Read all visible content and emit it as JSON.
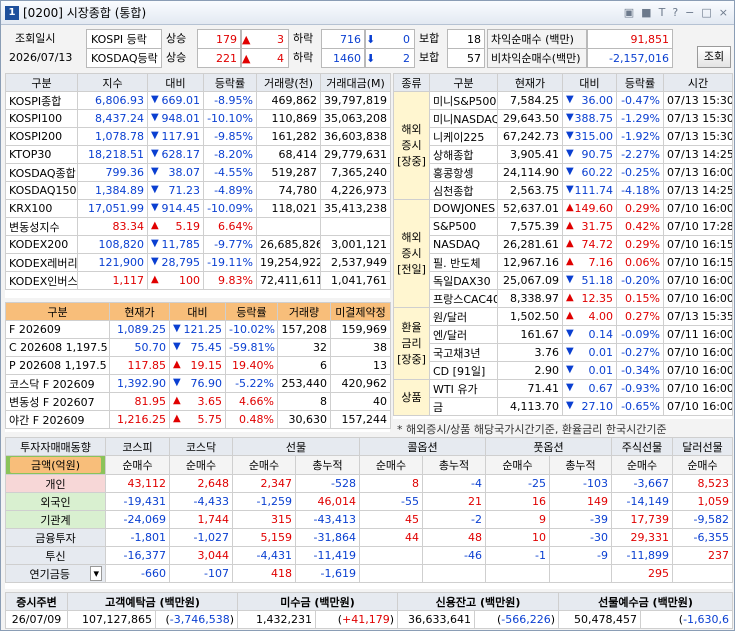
{
  "window": {
    "title_num": "1",
    "title": "[0200] 시장종합 (통합)",
    "buttons": [
      "▣",
      "■",
      "T",
      "?",
      "−",
      "□",
      "×"
    ]
  },
  "summary": {
    "query_label": "조회일시",
    "query_date": "2026/07/13",
    "kospi_label": "KOSPI 등락",
    "kosdaq_label": "KOSDAQ등락",
    "rise_label": "상승",
    "fall_label": "하락",
    "flat_label": "보합",
    "kospi": {
      "rise": "179",
      "rise_up": "3",
      "fall": "716",
      "fall_dn": "0",
      "flat": "18"
    },
    "kosdaq": {
      "rise": "221",
      "rise_up": "4",
      "fall": "1460",
      "fall_dn": "2",
      "flat": "57"
    },
    "arb_label": "차익순매수 (백만)",
    "arb_value": "91,851",
    "nonarb_label": "비차익순매수(백만)",
    "nonarb_value": "-2,157,016",
    "query_button": "조회"
  },
  "indices": {
    "headers": [
      "구분",
      "지수",
      "대비",
      "등락률",
      "거래량(천)",
      "거래대금(M)"
    ],
    "rows": [
      {
        "name": "KOSPI종합",
        "value": "6,806.93",
        "dir": "dn",
        "change": "669.01",
        "rate": "-8.95%",
        "vol": "469,862",
        "amt": "39,797,819"
      },
      {
        "name": "KOSPI100",
        "value": "8,437.24",
        "dir": "dn",
        "change": "948.01",
        "rate": "-10.10%",
        "vol": "110,869",
        "amt": "35,063,208"
      },
      {
        "name": "KOSPI200",
        "value": "1,078.78",
        "dir": "dn",
        "change": "117.91",
        "rate": "-9.85%",
        "vol": "161,282",
        "amt": "36,603,838"
      },
      {
        "name": "KTOP30",
        "value": "18,218.51",
        "dir": "dn",
        "change": "628.17",
        "rate": "-8.20%",
        "vol": "68,414",
        "amt": "29,779,631"
      },
      {
        "name": "KOSDAQ종합",
        "value": "799.36",
        "dir": "dn",
        "change": "38.07",
        "rate": "-4.55%",
        "vol": "519,287",
        "amt": "7,365,240"
      },
      {
        "name": "KOSDAQ150",
        "value": "1,384.89",
        "dir": "dn",
        "change": "71.23",
        "rate": "-4.89%",
        "vol": "74,780",
        "amt": "4,226,973"
      },
      {
        "name": "KRX100",
        "value": "17,051.99",
        "dir": "dn",
        "change": "914.45",
        "rate": "-10.09%",
        "vol": "118,021",
        "amt": "35,413,238"
      },
      {
        "name": "변동성지수",
        "value": "83.34",
        "dir": "up",
        "change": "5.19",
        "rate": "6.64%",
        "vol": "",
        "amt": ""
      },
      {
        "name": "KODEX200",
        "value": "108,820",
        "dir": "dn",
        "change": "11,785",
        "rate": "-9.77%",
        "vol": "26,685,826",
        "amt": "3,001,121"
      },
      {
        "name": "KODEX레버리",
        "value": "121,900",
        "dir": "dn",
        "change": "28,795",
        "rate": "-19.11%",
        "vol": "19,254,922",
        "amt": "2,537,949"
      },
      {
        "name": "KODEX인버스",
        "value": "1,117",
        "dir": "up",
        "change": "100",
        "rate": "9.83%",
        "vol": "72,411,611",
        "amt": "1,041,761"
      }
    ]
  },
  "futures": {
    "headers": [
      "구분",
      "현재가",
      "대비",
      "등락률",
      "거래량",
      "미결제약정"
    ],
    "rows": [
      {
        "name": "F 202609",
        "value": "1,089.25",
        "dir": "dn",
        "change": "121.25",
        "rate": "-10.02%",
        "vol": "157,208",
        "oi": "159,969"
      },
      {
        "name": "C 202608 1,197.5",
        "value": "50.70",
        "dir": "dn",
        "change": "75.45",
        "rate": "-59.81%",
        "vol": "32",
        "oi": "38"
      },
      {
        "name": "P 202608 1,197.5",
        "value": "117.85",
        "dir": "up",
        "change": "19.15",
        "rate": "19.40%",
        "vol": "6",
        "oi": "13"
      },
      {
        "name": "코스닥 F 202609",
        "value": "1,392.90",
        "dir": "dn",
        "change": "76.90",
        "rate": "-5.22%",
        "vol": "253,440",
        "oi": "420,962"
      },
      {
        "name": "변동성 F 202607",
        "value": "81.95",
        "dir": "up",
        "change": "3.65",
        "rate": "4.66%",
        "vol": "8",
        "oi": "40"
      },
      {
        "name": "야간 F 202609",
        "value": "1,216.25",
        "dir": "up",
        "change": "5.75",
        "rate": "0.48%",
        "vol": "30,630",
        "oi": "157,244"
      }
    ]
  },
  "global": {
    "headers": [
      "종류",
      "구분",
      "현재가",
      "대비",
      "등락률",
      "시간"
    ],
    "groups": [
      {
        "label": "해외\n증시\n[장중]",
        "rows": [
          {
            "name": "미니S&P500",
            "value": "7,584.25",
            "dir": "dn",
            "change": "36.00",
            "rate": "-0.47%",
            "time": "07/13 15:30"
          },
          {
            "name": "미니NASDAQ",
            "value": "29,643.50",
            "dir": "dn",
            "change": "388.75",
            "rate": "-1.29%",
            "time": "07/13 15:30"
          },
          {
            "name": "니케이225",
            "value": "67,242.73",
            "dir": "dn",
            "change": "315.00",
            "rate": "-1.92%",
            "time": "07/13 15:30"
          },
          {
            "name": "상해종합",
            "value": "3,905.41",
            "dir": "dn",
            "change": "90.75",
            "rate": "-2.27%",
            "time": "07/13 14:25"
          },
          {
            "name": "홍콩항셍",
            "value": "24,114.90",
            "dir": "dn",
            "change": "60.22",
            "rate": "-0.25%",
            "time": "07/13 16:00"
          },
          {
            "name": "심천종합",
            "value": "2,563.75",
            "dir": "dn",
            "change": "111.74",
            "rate": "-4.18%",
            "time": "07/13 14:25"
          }
        ]
      },
      {
        "label": "해외\n증시\n[전일]",
        "rows": [
          {
            "name": "DOWJONES",
            "value": "52,637.01",
            "dir": "up",
            "change": "149.60",
            "rate": "0.29%",
            "time": "07/10 16:00"
          },
          {
            "name": "S&P500",
            "value": "7,575.39",
            "dir": "up",
            "change": "31.75",
            "rate": "0.42%",
            "time": "07/10 17:28"
          },
          {
            "name": "NASDAQ",
            "value": "26,281.61",
            "dir": "up",
            "change": "74.72",
            "rate": "0.29%",
            "time": "07/10 16:15"
          },
          {
            "name": "필. 반도체",
            "value": "12,967.16",
            "dir": "up",
            "change": "7.16",
            "rate": "0.06%",
            "time": "07/10 16:15"
          },
          {
            "name": "독일DAX30",
            "value": "25,067.09",
            "dir": "dn",
            "change": "51.18",
            "rate": "-0.20%",
            "time": "07/10 16:00"
          },
          {
            "name": "프랑스CAC40",
            "value": "8,338.97",
            "dir": "up",
            "change": "12.35",
            "rate": "0.15%",
            "time": "07/10 16:00"
          }
        ]
      },
      {
        "label": "환율\n금리\n[장중]",
        "rows": [
          {
            "name": "원/달러",
            "value": "1,502.50",
            "dir": "up",
            "change": "4.00",
            "rate": "0.27%",
            "time": "07/13 15:35"
          },
          {
            "name": "엔/달러",
            "value": "161.67",
            "dir": "dn",
            "change": "0.14",
            "rate": "-0.09%",
            "time": "07/11 16:00"
          },
          {
            "name": "국고채3년",
            "value": "3.76",
            "dir": "dn",
            "change": "0.01",
            "rate": "-0.27%",
            "time": "07/10 16:00"
          },
          {
            "name": "CD [91일]",
            "value": "2.90",
            "dir": "dn",
            "change": "0.01",
            "rate": "-0.34%",
            "time": "07/10 16:00"
          }
        ]
      },
      {
        "label": "상품",
        "rows": [
          {
            "name": "WTI 유가",
            "value": "71.41",
            "dir": "dn",
            "change": "0.67",
            "rate": "-0.93%",
            "time": "07/10 16:00"
          },
          {
            "name": "금",
            "value": "4,113.70",
            "dir": "dn",
            "change": "27.10",
            "rate": "-0.65%",
            "time": "07/10 16:00"
          }
        ]
      }
    ],
    "note": "* 해외증시/상품 해당국가시간기준, 환율금리 한국시간기준"
  },
  "investors": {
    "title": "투자자매매동향",
    "unit_label": "금액(억원)",
    "top_headers": [
      "코스피",
      "코스닥",
      "선물",
      "콜옵션",
      "풋옵션",
      "주식선물",
      "달러선물"
    ],
    "sub_headers": [
      "순매수",
      "순매수",
      "순매수",
      "총누적",
      "순매수",
      "총누적",
      "순매수",
      "총누적",
      "순매수",
      "순매수"
    ],
    "rows": [
      {
        "name": "개인",
        "vals": [
          "43,112",
          "2,648",
          "2,347",
          "-528",
          "8",
          "-4",
          "-25",
          "-103",
          "-3,667",
          "8,523"
        ]
      },
      {
        "name": "외국인",
        "vals": [
          "-19,431",
          "-4,433",
          "-1,259",
          "46,014",
          "-55",
          "21",
          "16",
          "149",
          "-14,149",
          "1,059"
        ]
      },
      {
        "name": "기관계",
        "vals": [
          "-24,069",
          "1,744",
          "315",
          "-43,413",
          "45",
          "-2",
          "9",
          "-39",
          "17,739",
          "-9,582"
        ]
      },
      {
        "name": "금융투자",
        "vals": [
          "-1,801",
          "-1,027",
          "5,159",
          "-31,864",
          "44",
          "48",
          "10",
          "-30",
          "29,331",
          "-6,355"
        ]
      },
      {
        "name": "투신",
        "vals": [
          "-16,377",
          "3,044",
          "-4,431",
          "-11,419",
          "",
          "-46",
          "-1",
          "-9",
          "-11,899",
          "237"
        ]
      },
      {
        "name": "연기금등",
        "vals": [
          "-660",
          "-107",
          "418",
          "-1,619",
          "",
          "",
          "",
          "",
          "295",
          ""
        ]
      }
    ]
  },
  "bottom": {
    "headers": [
      "증시주변",
      "고객예탁금 (백만원)",
      "미수금 (백만원)",
      "신용잔고 (백만원)",
      "선물예수금 (백만원)"
    ],
    "date": "26/07/09",
    "deposit": "107,127,865",
    "deposit_chg": "-3,746,538",
    "unpaid": "1,432,231",
    "unpaid_chg": "+41,179",
    "credit": "36,633,641",
    "credit_chg": "-566,226",
    "fut_dep": "50,478,457",
    "fut_dep_chg": "-1,630,6"
  },
  "colors": {
    "rise": "#e00000",
    "fall": "#0a3fd1",
    "header_bg": "#e6eaf0",
    "orange": "#f8be7a",
    "group_bg": "#fff6d0",
    "pink": "#f7d7d7",
    "green": "#d9f0d0"
  }
}
